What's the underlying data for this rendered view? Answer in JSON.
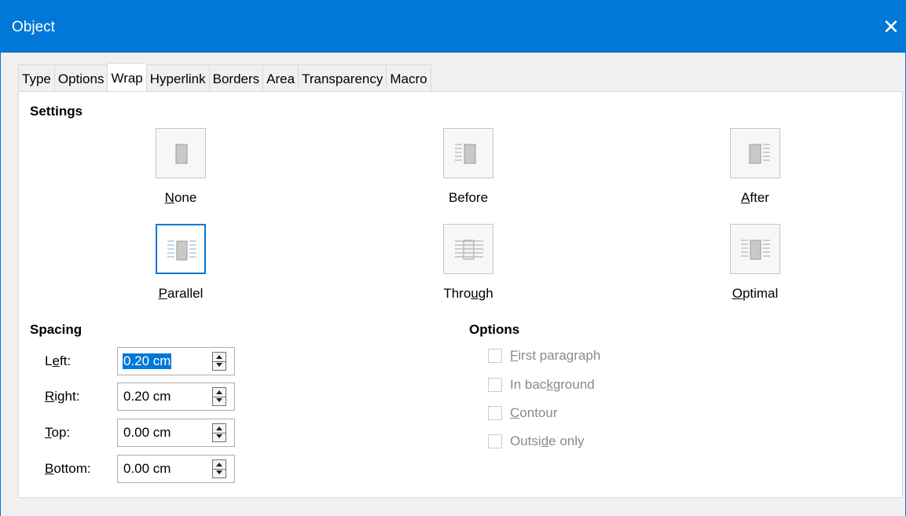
{
  "window": {
    "title": "Object",
    "close_glyph": "✕"
  },
  "tabs": [
    {
      "label": "Type"
    },
    {
      "label": "Options"
    },
    {
      "label": "Wrap",
      "active": true
    },
    {
      "label": "Hyperlink"
    },
    {
      "label": "Borders"
    },
    {
      "label": "Area"
    },
    {
      "label": "Transparency"
    },
    {
      "label": "Macro"
    }
  ],
  "settings": {
    "title": "Settings",
    "options": [
      {
        "pre": "",
        "u": "N",
        "post": "one",
        "icon": "wrap-none-icon",
        "selected": false
      },
      {
        "pre": "Before",
        "u": "",
        "post": "",
        "icon": "wrap-before-icon",
        "selected": false
      },
      {
        "pre": "",
        "u": "A",
        "post": "fter",
        "icon": "wrap-after-icon",
        "selected": false
      },
      {
        "pre": "",
        "u": "P",
        "post": "arallel",
        "icon": "wrap-parallel-icon",
        "selected": true
      },
      {
        "pre": "Thro",
        "u": "u",
        "post": "gh",
        "icon": "wrap-through-icon",
        "selected": false
      },
      {
        "pre": "",
        "u": "O",
        "post": "ptimal",
        "icon": "wrap-optimal-icon",
        "selected": false
      }
    ]
  },
  "spacing": {
    "title": "Spacing",
    "fields": [
      {
        "pre": "L",
        "u": "e",
        "post": "ft:",
        "value": "0.20 cm",
        "selected": true
      },
      {
        "pre": "",
        "u": "R",
        "post": "ight:",
        "value": "0.20 cm",
        "selected": false
      },
      {
        "pre": "",
        "u": "T",
        "post": "op:",
        "value": "0.00 cm",
        "selected": false
      },
      {
        "pre": "",
        "u": "B",
        "post": "ottom:",
        "value": "0.00 cm",
        "selected": false
      }
    ]
  },
  "options": {
    "title": "Options",
    "checkboxes": [
      {
        "pre": "",
        "u": "F",
        "post": "irst paragraph",
        "checked": false
      },
      {
        "pre": "In bac",
        "u": "k",
        "post": "ground",
        "checked": false
      },
      {
        "pre": "",
        "u": "C",
        "post": "ontour",
        "checked": false
      },
      {
        "pre": "Outsi",
        "u": "d",
        "post": "e only",
        "checked": false
      }
    ]
  },
  "colors": {
    "accent": "#0078d7",
    "disabled_text": "#8a8a8a"
  }
}
